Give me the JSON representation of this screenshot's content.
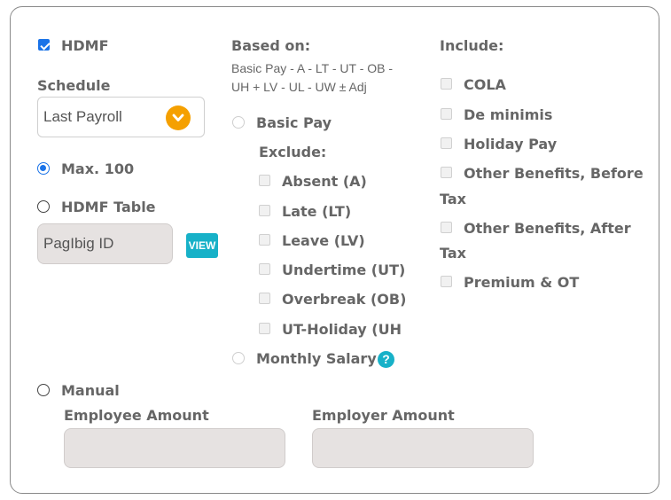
{
  "hdmf": {
    "label": "HDMF",
    "checked": true
  },
  "schedule": {
    "label": "Schedule",
    "value": "Last Payroll",
    "icon": "chevron-down-icon"
  },
  "max": {
    "label": "Max. 100",
    "selected": true
  },
  "hdmf_table": {
    "label": "HDMF Table",
    "selected": false,
    "field_value": "PagIbig ID",
    "view_label": "VIEW"
  },
  "based_on": {
    "label": "Based on:",
    "formula_line1": "Basic Pay - A - LT - UT - OB -",
    "formula_line2": "UH + LV - UL - UW ± Adj",
    "basic_pay_label": "Basic Pay",
    "exclude_label": "Exclude:",
    "exclude_items": [
      {
        "label": "Absent (A)",
        "checked": false
      },
      {
        "label": "Late (LT)",
        "checked": false
      },
      {
        "label": "Leave (LV)",
        "checked": false
      },
      {
        "label": "Undertime (UT)",
        "checked": false
      },
      {
        "label": "Overbreak (OB)",
        "checked": false
      },
      {
        "label": "UT-Holiday (UH",
        "checked": false
      }
    ],
    "monthly_salary_label": "Monthly Salary",
    "help_icon": "?"
  },
  "include": {
    "label": "Include:",
    "items": [
      {
        "label": "COLA",
        "checked": false
      },
      {
        "label": "De minimis",
        "checked": false
      },
      {
        "label": "Holiday Pay",
        "checked": false
      },
      {
        "label": "Other Benefits, Before",
        "label_wrap": "Tax",
        "checked": false
      },
      {
        "label": "Other Benefits, After",
        "label_wrap": "Tax",
        "checked": false
      },
      {
        "label": "Premium & OT",
        "checked": false
      }
    ]
  },
  "manual": {
    "label": "Manual",
    "selected": false,
    "employee_label": "Employee Amount",
    "employee_value": "",
    "employer_label": "Employer Amount",
    "employer_value": ""
  },
  "colors": {
    "accent_blue": "#1a73e8",
    "orange": "#f5a000",
    "teal": "#17b1c8",
    "field_bg": "#e6e2e1"
  }
}
